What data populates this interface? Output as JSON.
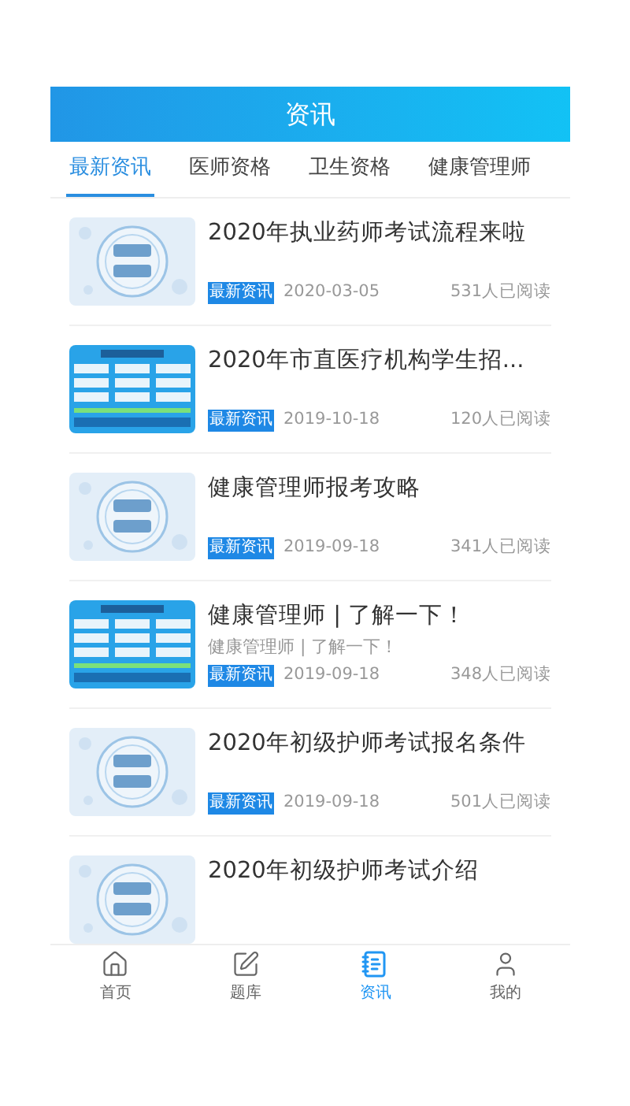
{
  "header": {
    "title": "资讯"
  },
  "tabs": [
    {
      "label": "最新资讯",
      "selected": true
    },
    {
      "label": "医师资格",
      "selected": false
    },
    {
      "label": "卫生资格",
      "selected": false
    },
    {
      "label": "健康管理师",
      "selected": false
    }
  ],
  "articles": [
    {
      "kind": "focus",
      "title": "2020年执业药师考试流程来啦",
      "tag": "最新资讯",
      "date": "2020-03-05",
      "reads": "531人已阅读"
    },
    {
      "kind": "board",
      "title": "2020年市直医疗机构学生招...",
      "tag": "最新资讯",
      "date": "2019-10-18",
      "reads": "120人已阅读"
    },
    {
      "kind": "focus",
      "title": "健康管理师报考攻略",
      "tag": "最新资讯",
      "date": "2019-09-18",
      "reads": "341人已阅读"
    },
    {
      "kind": "board",
      "title": "健康管理师 | 了解一下！",
      "summary": "健康管理师 | 了解一下！",
      "tag": "最新资讯",
      "date": "2019-09-18",
      "reads": "348人已阅读"
    },
    {
      "kind": "focus",
      "title": "2020年初级护师考试报名条件",
      "tag": "最新资讯",
      "date": "2019-09-18",
      "reads": "501人已阅读"
    },
    {
      "kind": "focus",
      "title": "2020年初级护师考试介绍"
    }
  ],
  "bottom_nav": [
    {
      "kind": "home",
      "label": "首页",
      "selected": false
    },
    {
      "kind": "bank",
      "label": "题库",
      "selected": false
    },
    {
      "kind": "news",
      "label": "资讯",
      "selected": true
    },
    {
      "kind": "profile",
      "label": "我的",
      "selected": false
    }
  ]
}
